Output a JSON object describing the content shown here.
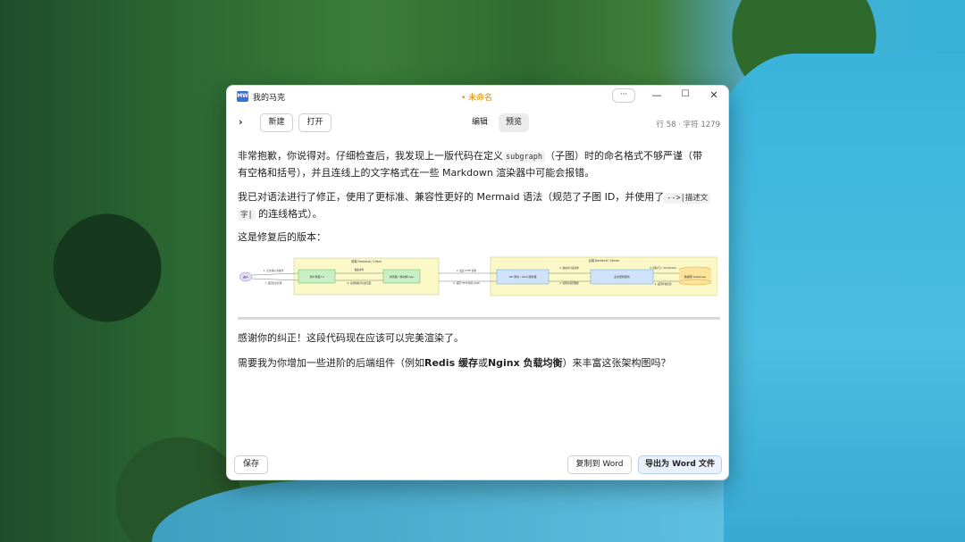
{
  "window": {
    "app_name": "我的马克",
    "app_icon_text": "MW",
    "doc_title": "• 未命名",
    "more": "···",
    "minimize": "—",
    "maximize": "☐",
    "close": "✕"
  },
  "toolbar": {
    "expand": "›",
    "new_label": "新建",
    "open_label": "打开",
    "tabs": [
      {
        "label": "编辑"
      },
      {
        "label": "预览"
      }
    ],
    "stats": "行 58 · 字符 1279"
  },
  "content": {
    "p1_a": "非常抱歉，你说得对。仔细检查后，我发现上一版代码在定义",
    "p1_code": "subgraph",
    "p1_b": "（子图）时的命名格式不够严谨（带",
    "p1_c": "有空格和括号），并且连线上的文字格式在一些 Markdown 渲染器中可能会报错。",
    "p2_a": "我已对语法进行了修正，使用了更标准、兼容性更好的 Mermaid 语法（规范了子图 ID，并使用了",
    "p2_code1": "-->|描述文",
    "p2_code2": "字|",
    "p2_b": "的连线格式）。",
    "p3": "这是修复后的版本：",
    "p4": "感谢你的纠正！这段代码现在应该可以完美渲染了。",
    "p5_a": "需要我为你增加一些进阶的后端组件（例如",
    "p5_b1": "Redis 缓存",
    "p5_or": "或",
    "p5_b2": "Nginx 负载均衡",
    "p5_c": "）来丰富这张架构图吗？"
  },
  "diagram": {
    "user": "用户",
    "frontend_title": "前端 Frontend / Client",
    "fe_node1": "用户界面 UI",
    "fe_node2": "浏览器 / 移动端 App",
    "backend_title": "后端 Backend / Server",
    "be_node1": "API 网关 / Web 服务器",
    "be_node2": "业务逻辑服务",
    "db": "数据库 Database",
    "e1": "1. 点击/输入等操作",
    "e2": "7. 返回显示结果",
    "e3": "触发事件",
    "e4": "6. 更新数据并渲染页面",
    "e5": "2. 发送 HTTP 请求",
    "e6": "5. 返回 HTTP 响应 JSON",
    "e7": "3. 路由并分发请求",
    "e8": "4. 处理并返回数据",
    "e9": "4. 读取/写入 SQL/NoSQL",
    "e10": "4. 返回查询结果"
  },
  "footer": {
    "save_label": "保存",
    "copy_word_label": "复制到 Word",
    "export_word_label": "导出为 Word 文件"
  }
}
